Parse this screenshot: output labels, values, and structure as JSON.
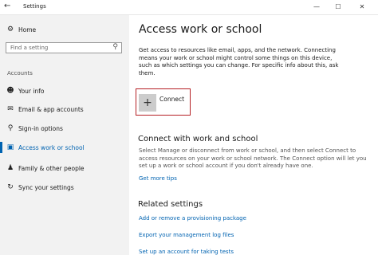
{
  "window": {
    "title": "Settings",
    "back_icon": "back-arrow-icon",
    "controls": [
      "minimize",
      "maximize",
      "close"
    ]
  },
  "sidebar": {
    "home_label": "Home",
    "search_placeholder": "Find a setting",
    "section_label": "Accounts",
    "items": [
      {
        "label": "Your info",
        "icon": "person-icon"
      },
      {
        "label": "Email & app accounts",
        "icon": "mail-icon"
      },
      {
        "label": "Sign-in options",
        "icon": "key-icon"
      },
      {
        "label": "Access work or school",
        "icon": "briefcase-icon",
        "active": true
      },
      {
        "label": "Family & other people",
        "icon": "people-icon"
      },
      {
        "label": "Sync your settings",
        "icon": "sync-icon"
      }
    ]
  },
  "main": {
    "title": "Access work or school",
    "description": "Get access to resources like email, apps, and the network. Connecting means your work or school might control some things on this device, such as which settings you can change. For specific info about this, ask them.",
    "connect_label": "Connect",
    "connect_section": {
      "heading": "Connect with work and school",
      "description": "Select Manage or disconnect from work or school, and then select Connect to access resources on your work or school network. The Connect option will let you set up a work or school account if you don't already have one.",
      "link": "Get more tips"
    },
    "related": {
      "heading": "Related settings",
      "links": [
        "Add or remove a provisioning package",
        "Export your management log files",
        "Set up an account for taking tests"
      ]
    }
  },
  "colors": {
    "accent": "#0063b1",
    "highlight_border": "#b52025",
    "sidebar_bg": "#f2f2f2"
  }
}
